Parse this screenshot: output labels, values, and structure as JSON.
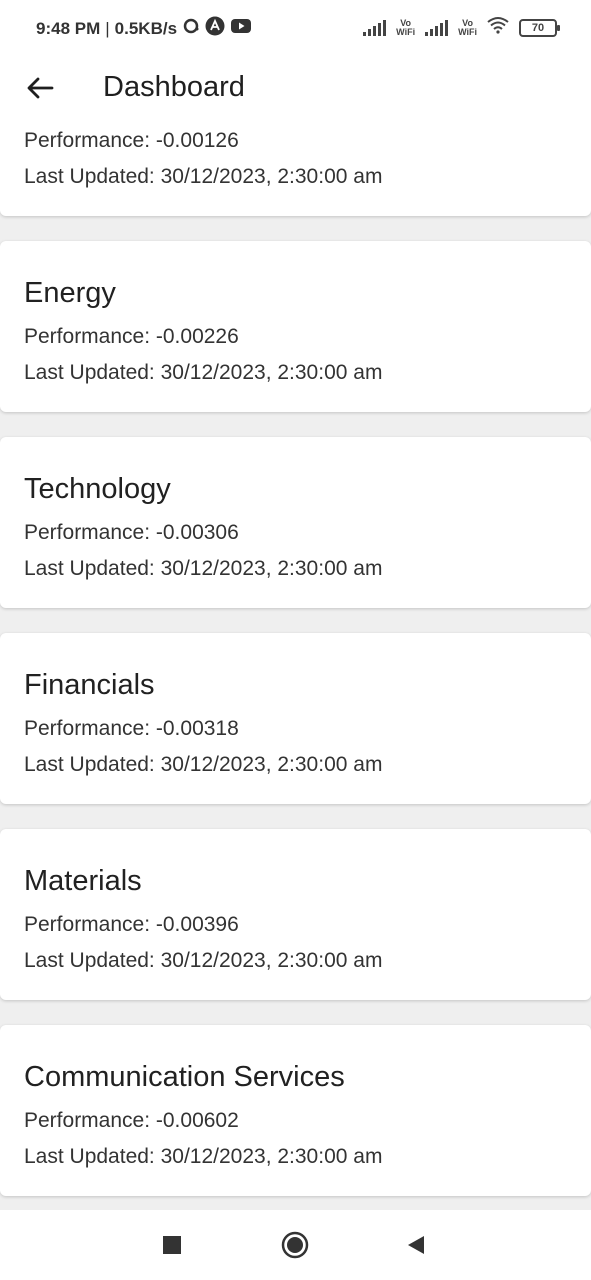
{
  "status_bar": {
    "time": "9:48 PM",
    "separator": "|",
    "network_speed": "0.5KB/s",
    "battery_level": "70",
    "icons": [
      "chat-icon",
      "autopilot-icon",
      "youtube-icon",
      "signal-icon",
      "vowifi-icon",
      "signal-icon",
      "vowifi-icon",
      "wifi-icon",
      "battery-icon"
    ],
    "vowifi_label_1": "Vo\nWiFi",
    "vowifi_label_2": "Vo\nWiFi"
  },
  "app_bar": {
    "title": "Dashboard",
    "back_icon": "arrow-back-icon"
  },
  "cards": [
    {
      "sector": "",
      "performance": "Performance: -0.00126",
      "last_updated": "Last Updated: 30/12/2023, 2:30:00 am"
    },
    {
      "sector": "Energy",
      "performance": "Performance: -0.00226",
      "last_updated": "Last Updated: 30/12/2023, 2:30:00 am"
    },
    {
      "sector": "Technology",
      "performance": "Performance: -0.00306",
      "last_updated": "Last Updated: 30/12/2023, 2:30:00 am"
    },
    {
      "sector": "Financials",
      "performance": "Performance: -0.00318",
      "last_updated": "Last Updated: 30/12/2023, 2:30:00 am"
    },
    {
      "sector": "Materials",
      "performance": "Performance: -0.00396",
      "last_updated": "Last Updated: 30/12/2023, 2:30:00 am"
    },
    {
      "sector": "Communication Services",
      "performance": "Performance: -0.00602",
      "last_updated": "Last Updated: 30/12/2023, 2:30:00 am"
    }
  ],
  "nav_bar": {
    "icons": [
      "recents-square-icon",
      "home-circle-icon",
      "back-triangle-icon"
    ]
  },
  "colors": {
    "background": "#efefef",
    "card": "#ffffff",
    "text_primary": "#212121",
    "text_secondary": "#333333"
  }
}
